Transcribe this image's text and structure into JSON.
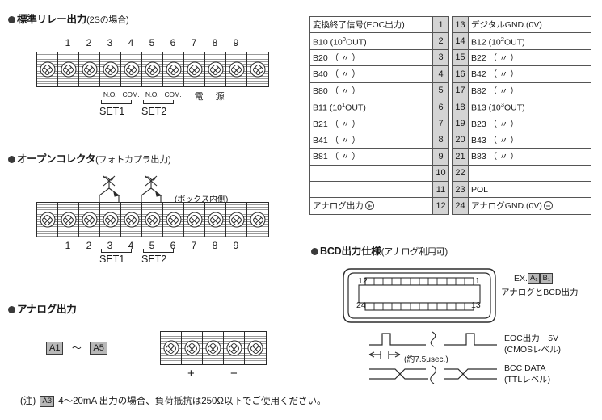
{
  "sections": {
    "relay": {
      "heading": "標準リレー出力",
      "heading_sub": "(2Sの場合)",
      "terminal_numbers": [
        "1",
        "2",
        "3",
        "4",
        "5",
        "6",
        "7",
        "8",
        "9"
      ],
      "sub_labels": [
        "N.O.",
        "COM.",
        "N.O.",
        "COM."
      ],
      "power_label_1": "電",
      "power_label_2": "源",
      "set1": "SET1",
      "set2": "SET2"
    },
    "open_collector": {
      "heading": "オープンコレクタ",
      "heading_sub": "(フォトカプラ出力)",
      "inner_note": "(ボックス内側)",
      "terminal_numbers": [
        "1",
        "2",
        "3",
        "4",
        "5",
        "6",
        "7",
        "8",
        "9"
      ],
      "set1": "SET1",
      "set2": "SET2"
    },
    "analog": {
      "heading": "アナログ出力",
      "badge_from": "A1",
      "badge_to": "A5",
      "range_tilde": "～",
      "plus": "+",
      "minus": "−"
    },
    "bcd": {
      "heading": "BCD出力仕様",
      "heading_sub": "(アナログ利用可)",
      "pin_top_left": "12",
      "pin_top_right": "1",
      "pin_bottom_left": "24",
      "pin_bottom_right": "13",
      "ex_prefix": "EX.",
      "ex_badge_a": "A₁",
      "ex_badge_b": "B₁",
      "ex_colon": ":",
      "ex_text": "アナログとBCD出力",
      "timing": {
        "eoc_label_1": "EOC出力　5V",
        "eoc_label_2": "(CMOSレベル)",
        "usec": "(約7.5μsec.)",
        "bcc_label_1": "BCC DATA",
        "bcc_label_2": "(TTLレベル)"
      }
    }
  },
  "pin_table": {
    "rows": [
      {
        "left": "変換終了信号(EOC出力)",
        "ln": "1",
        "rn": "13",
        "right": "デジタルGND.(0V)"
      },
      {
        "left": "B10 (10⁰OUT)",
        "ln": "2",
        "rn": "14",
        "right": "B12 (10²OUT)"
      },
      {
        "left": "B20 （ 〃 ）",
        "ln": "3",
        "rn": "15",
        "right": "B22 （ 〃 ）"
      },
      {
        "left": "B40 （ 〃 ）",
        "ln": "4",
        "rn": "16",
        "right": "B42 （ 〃 ）"
      },
      {
        "left": "B80 （ 〃 ）",
        "ln": "5",
        "rn": "17",
        "right": "B82 （ 〃 ）"
      },
      {
        "left": "B11 (10¹OUT)",
        "ln": "6",
        "rn": "18",
        "right": "B13 (10³OUT)"
      },
      {
        "left": "B21 （ 〃 ）",
        "ln": "7",
        "rn": "19",
        "right": "B23 （ 〃 ）"
      },
      {
        "left": "B41 （ 〃 ）",
        "ln": "8",
        "rn": "20",
        "right": "B43 （ 〃 ）"
      },
      {
        "left": "B81 （ 〃 ）",
        "ln": "9",
        "rn": "21",
        "right": "B83 （ 〃 ）"
      },
      {
        "left": "",
        "ln": "10",
        "rn": "22",
        "right": ""
      },
      {
        "left": "",
        "ln": "11",
        "rn": "23",
        "right": "POL"
      },
      {
        "left": "アナログ出力",
        "ln": "12",
        "rn": "24",
        "right": "アナログGND.(0V)"
      }
    ]
  },
  "footnote": {
    "prefix": "(注)",
    "badge": "A3",
    "text": "4～20mA 出力の場合、負荷抵抗は250Ω以下でご使用ください。"
  },
  "colors": {
    "line": "#2b2b2b",
    "table_num_bg": "#d4d4d4",
    "badge_bg": "#b8b8b8",
    "bullet": "#3a3a3a"
  }
}
